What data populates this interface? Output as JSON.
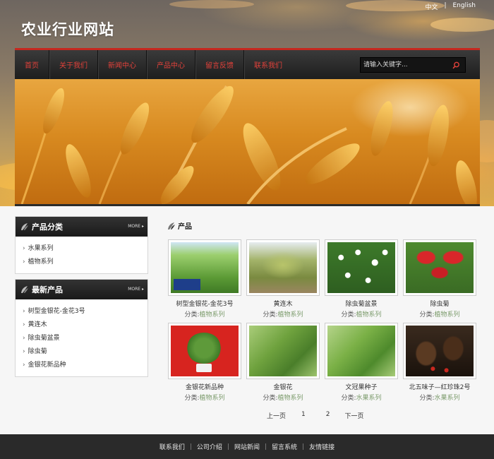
{
  "header": {
    "site_title": "农业行业网站",
    "lang": [
      "中文",
      "English"
    ]
  },
  "nav": {
    "items": [
      "首页",
      "关于我们",
      "新闻中心",
      "产品中心",
      "留言反馈",
      "联系我们"
    ],
    "search_placeholder": "请输入关键字..."
  },
  "sidebar": {
    "categories": {
      "title": "产品分类",
      "more": "MORE",
      "items": [
        "水果系列",
        "植物系列"
      ]
    },
    "latest": {
      "title": "最新产品",
      "more": "MORE",
      "items": [
        "树型金银花-金花3号",
        "黄连木",
        "除虫菊盆景",
        "除虫菊",
        "金银花新品种"
      ]
    }
  },
  "products": {
    "title": "产品",
    "cat_prefix": "分类:",
    "items": [
      {
        "name": "树型金银花-金花3号",
        "category": "植物系列"
      },
      {
        "name": "黄连木",
        "category": "植物系列"
      },
      {
        "name": "除虫菊盆景",
        "category": "植物系列"
      },
      {
        "name": "除虫菊",
        "category": "植物系列"
      },
      {
        "name": "金银花新品种",
        "category": "植物系列"
      },
      {
        "name": "金银花",
        "category": "植物系列"
      },
      {
        "name": "文冠果种子",
        "category": "水果系列"
      },
      {
        "name": "北五味子—红珍珠2号",
        "category": "水果系列"
      }
    ]
  },
  "pager": {
    "prev": "上一页",
    "pages": [
      "1",
      "2"
    ],
    "next": "下一页"
  },
  "footer": {
    "links": [
      "联系我们",
      "公司介绍",
      "网站新闻",
      "留言系统",
      "友情链接"
    ]
  }
}
